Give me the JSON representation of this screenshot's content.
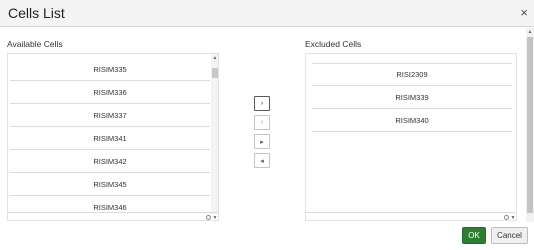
{
  "dialog": {
    "title": "Cells List",
    "close_glyph": "×"
  },
  "available": {
    "label": "Available Cells",
    "items": [
      "RISIM335",
      "RISIM336",
      "RISIM337",
      "RISIM341",
      "RISIM342",
      "RISIM345",
      "RISIM346"
    ]
  },
  "excluded": {
    "label": "Excluded Cells",
    "items": [
      "RISI2309",
      "RISIM339",
      "RISIM340"
    ]
  },
  "transfer": {
    "move_right_glyph": "›",
    "move_left_glyph": "‹",
    "move_all_right_glyph": "▸",
    "move_all_left_glyph": "◂"
  },
  "footer": {
    "ok_label": "OK",
    "cancel_label": "Cancel"
  },
  "colors": {
    "ok_button": "#2f7d32"
  },
  "icons": {
    "close": "close-icon",
    "scroll_up": "scroll-up-icon",
    "scroll_down": "scroll-down-icon",
    "resize_grip": "resize-grip-icon"
  }
}
